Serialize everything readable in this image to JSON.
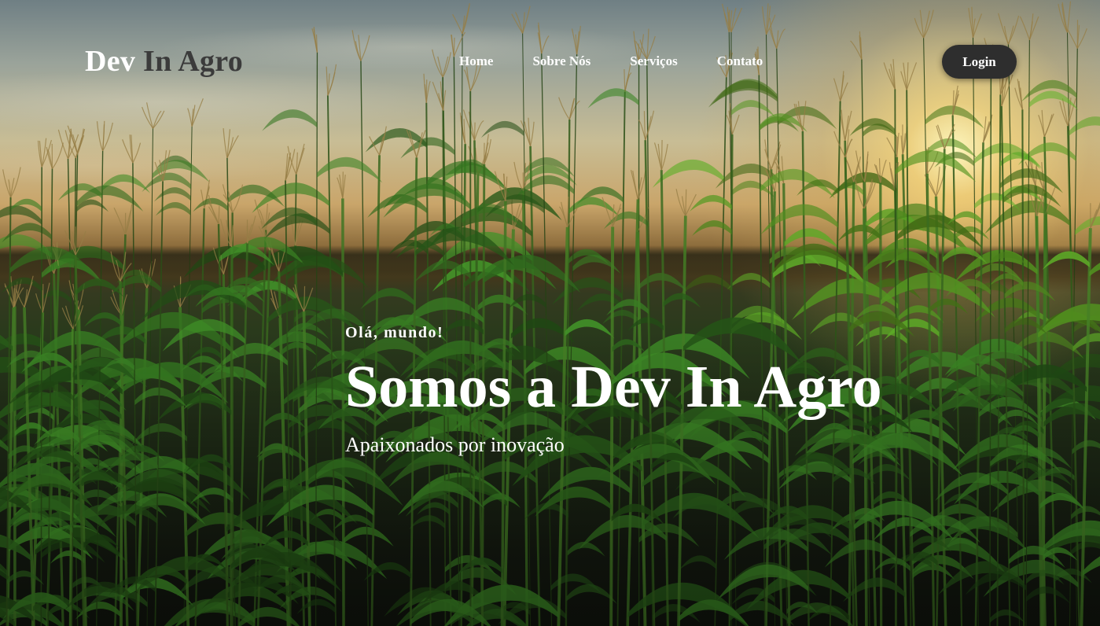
{
  "brand": {
    "first": "Dev",
    "second": "In Agro"
  },
  "nav": {
    "items": [
      {
        "label": "Home"
      },
      {
        "label": "Sobre Nós"
      },
      {
        "label": "Serviços"
      },
      {
        "label": "Contato"
      }
    ],
    "login_label": "Login"
  },
  "hero": {
    "eyebrow": "Olá, mundo!",
    "headline": "Somos a Dev In Agro",
    "subheadline": "Apaixonados por inovação",
    "background": "cornfield-sunset-photo"
  },
  "colors": {
    "text": "#ffffff",
    "brand_secondary": "#3b3b3b",
    "login_button_bg": "#2e2e2e"
  }
}
